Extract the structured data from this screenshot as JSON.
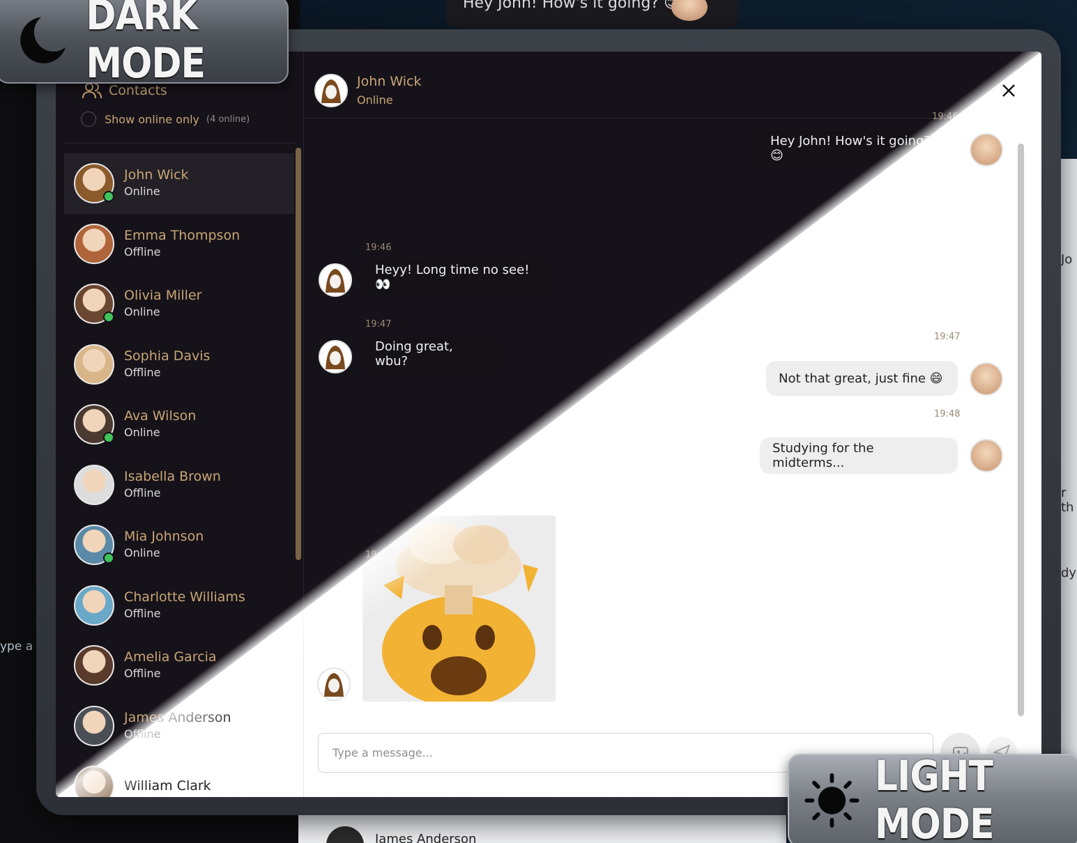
{
  "badges": {
    "dark": "DARK MODE",
    "light": "LIGHT MODE"
  },
  "background": {
    "top_bubble": "Hey John! How's it going? 😊",
    "right_text_1": "Jo",
    "right_text_2": "r th",
    "right_text_3": "dyi",
    "bottom_name": "James Anderson",
    "type_hint": "ype a"
  },
  "sidebar": {
    "title": "Contacts",
    "toggle_label": "Show online only",
    "online_count": "(4 online)",
    "contacts": [
      {
        "name": "John Wick",
        "status": "Online",
        "online": true,
        "active": true,
        "color": "#8a5a2b"
      },
      {
        "name": "Emma Thompson",
        "status": "Offline",
        "online": false,
        "color": "#b0643a"
      },
      {
        "name": "Olivia Miller",
        "status": "Online",
        "online": true,
        "color": "#6b4630"
      },
      {
        "name": "Sophia Davis",
        "status": "Offline",
        "online": false,
        "color": "#d9b68a"
      },
      {
        "name": "Ava Wilson",
        "status": "Online",
        "online": true,
        "color": "#4a3a30"
      },
      {
        "name": "Isabella Brown",
        "status": "Offline",
        "online": false,
        "color": "#dddddd"
      },
      {
        "name": "Mia Johnson",
        "status": "Online",
        "online": true,
        "color": "#5a8aa8"
      },
      {
        "name": "Charlotte Williams",
        "status": "Offline",
        "online": false,
        "color": "#6aa8c8"
      },
      {
        "name": "Amelia Garcia",
        "status": "Offline",
        "online": false,
        "color": "#5a3a2a"
      },
      {
        "name": "James Anderson",
        "status": "Offline",
        "online": false,
        "color": "#4a4f55"
      },
      {
        "name": "William Clark",
        "status": "",
        "online": false,
        "color": "#8a6a50"
      }
    ]
  },
  "chat": {
    "contact_name": "John Wick",
    "contact_status": "Online",
    "input_placeholder": "Type a message...",
    "messages": [
      {
        "time": "19:46",
        "text": "Hey John! How's it going? 😊",
        "from": "me"
      },
      {
        "time": "19:46",
        "text": "Heyy! Long time no see! 👀",
        "from": "them"
      },
      {
        "time": "19:47",
        "text": "Doing great, wbu?",
        "from": "them"
      },
      {
        "time": "19:47",
        "text": "Not that great, just fine 😄",
        "from": "me"
      },
      {
        "time": "19:48",
        "text": "Studying for the midterms...",
        "from": "me"
      },
      {
        "time": "19:48",
        "text": "🤯",
        "from": "them"
      }
    ]
  },
  "colors": {
    "accent": "#c9a675",
    "online": "#3fc35a",
    "dark_bg": "#16121a"
  }
}
